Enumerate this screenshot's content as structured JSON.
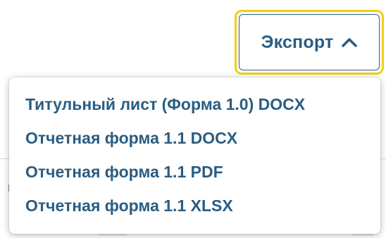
{
  "export_button": {
    "label": "Экспорт",
    "icon": "chevron-up-icon",
    "focus_ring_color": "#f2cf14",
    "text_color": "#2a5d82"
  },
  "dropdown": {
    "items": [
      {
        "label": "Титульный лист (Форма 1.0) DOCX"
      },
      {
        "label": "Отчетная форма 1.1 DOCX"
      },
      {
        "label": "Отчетная форма 1.1 PDF"
      },
      {
        "label": "Отчетная форма 1.1 XLSX"
      }
    ]
  }
}
